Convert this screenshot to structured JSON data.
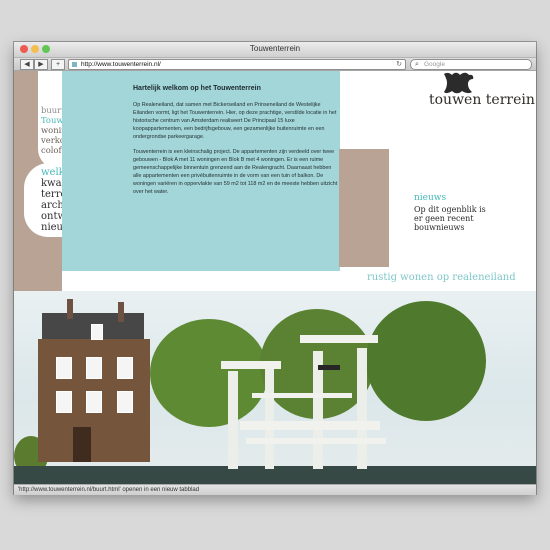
{
  "browser": {
    "title": "Touwenterrein",
    "url": "http://www.touwenterrein.nl/",
    "search_placeholder": "Google",
    "status": "'http://www.touwenterrein.nl/buurt.html' openen in een nieuw tabblad"
  },
  "site": {
    "brand": "touwen terrein",
    "left_nav_small": [
      "buurt",
      "Touwenterrein",
      "woningen",
      "verkoop",
      "colofon."
    ],
    "left_nav_big": [
      "welkom,",
      "kwaliteiten,",
      "terrein,",
      "architect",
      "ontwikkelaar",
      "nieuws"
    ],
    "content": {
      "title": "Hartelijk welkom op het Touwenterrein",
      "paragraphs": [
        "Op Realeneiland, dat samen met Bickerseiland en Prinseneiland de Westelijke Eilanden vormt, ligt het Touwenterrein. Hier, op deze prachtige, verstilde locatie in het historische centrum van Amsterdam realiseert De Principaal 15 luxe koopappartementen, een bedrijfsgebouw, een gezamenlijke buitenruimte en een ondergrondse parkeergarage.",
        "Touwenterrein is een kleinschalig project. De appartementen zijn verdeeld over twee gebouwen - Blok A met 11 woningen en Blok B met 4 woningen. Er is een ruime gemeenschappelijke binnentuin grenzend aan de Realengracht. Daarnaast hebben alle appartementen een privébuitenruimte in de vorm van een tuin of balkon. De woningen variëren in oppervlakte van 59 m2 tot 118 m2 en de meeste hebben uitzicht over het water."
      ]
    },
    "news": {
      "title": "nieuws",
      "text": "Op dit ogenblik is er geen recent bouwnieuws"
    },
    "photo_caption": "rustig wonen op realeneiland",
    "colors": {
      "teal": "#a3d6d8",
      "brown": "#b9a395",
      "accent": "#46b9b9",
      "text": "#243134"
    }
  },
  "icons": {
    "back": "back-arrow",
    "forward": "forward-arrow",
    "add": "plus",
    "reload": "reload",
    "search": "search-icon"
  }
}
